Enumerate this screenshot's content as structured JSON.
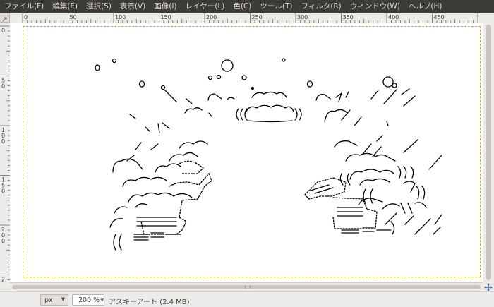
{
  "menubar": {
    "items": [
      "ファイル(F)",
      "編集(E)",
      "選択(S)",
      "表示(V)",
      "画像(I)",
      "レイヤー(L)",
      "色(C)",
      "ツール(T)",
      "フィルタ(R)",
      "ウィンドウ(W)",
      "ヘルプ(H)"
    ]
  },
  "ruler": {
    "h_labels": [
      "0",
      "50",
      "100",
      "150",
      "200",
      "250",
      "300",
      "350",
      "400",
      "450"
    ],
    "v_labels": [
      "0",
      "50",
      "100",
      "150",
      "200",
      "250"
    ]
  },
  "status": {
    "unit": "px",
    "zoom": "200 %",
    "message": "アスキーアート (2.4 MB)"
  },
  "colors": {
    "menubar_bg": "#3c3b37",
    "menubar_text": "#dfdbd2",
    "boundary": "#c8b400",
    "nav_icon": "#3f6fb5"
  },
  "canvas": {
    "art_lines": [
      "o  °                    O",
      "o  °    ,     ﾟ o  (⌒⌒)   o   r⌒ヽ/,",
      "＼ ((⌒⌒)) (⌒⌒)",
      "(⌒-ヽ(⌒⌒)  (⌒⌒))))",
      "(⌒≡二一      一二≡⌒)ﾉ;;ﾉﾉ"
    ]
  }
}
